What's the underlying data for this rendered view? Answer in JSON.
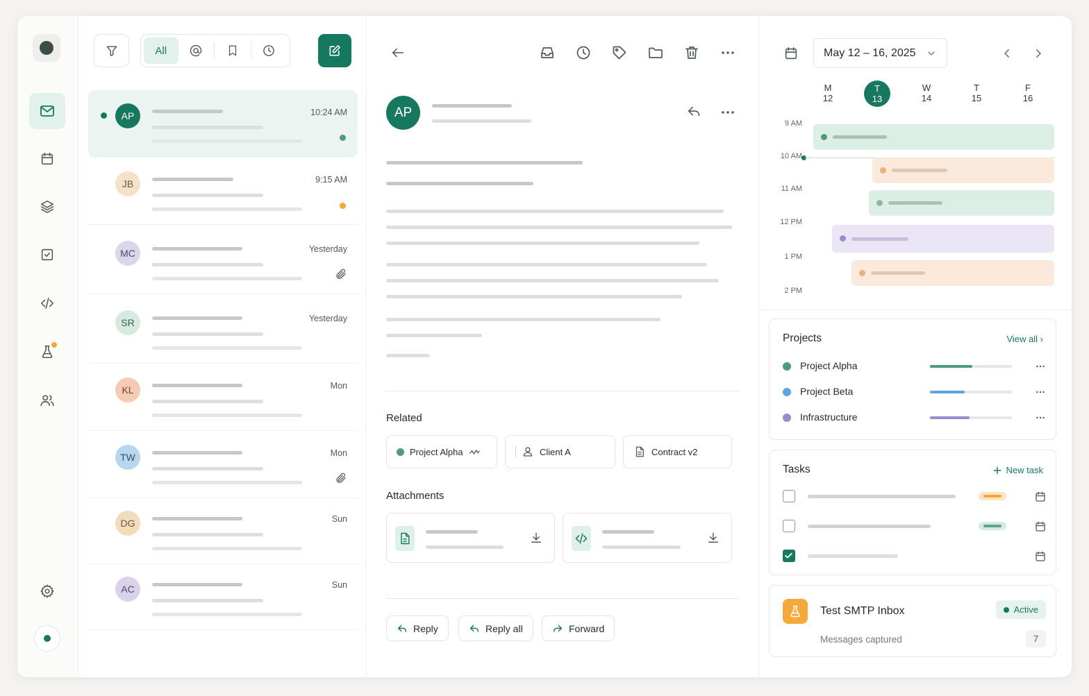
{
  "colors": {
    "accent": "#16785f",
    "warning": "#f0a93a",
    "blue": "#5aa6dd",
    "purple": "#9b8ad0"
  },
  "rail": {
    "items": [
      {
        "name": "mail",
        "icon": "mail-icon",
        "active": true
      },
      {
        "name": "calendar",
        "icon": "calendar-icon"
      },
      {
        "name": "layers",
        "icon": "layers-icon"
      },
      {
        "name": "tasks",
        "icon": "checkbox-icon"
      },
      {
        "name": "code",
        "icon": "code-icon"
      },
      {
        "name": "lab",
        "icon": "flask-icon",
        "badge": true
      },
      {
        "name": "contacts",
        "icon": "users-icon"
      }
    ],
    "settings_icon": "gear-icon"
  },
  "mail_list": {
    "filter_icon": "filter-icon",
    "tabs": {
      "all": "All",
      "mentions_icon": "at-icon",
      "saved_icon": "bookmark-icon",
      "snoozed_icon": "clock-icon"
    },
    "compose_icon": "compose-icon",
    "items": [
      {
        "initials": "AP",
        "time": "10:24 AM",
        "selected": true,
        "unread": true,
        "indicator": "#4f9a7d",
        "avatar_bg": "#16785f",
        "avatar_fg": "#ffffff"
      },
      {
        "initials": "JB",
        "time": "9:15 AM",
        "indicator": "#f0a93a",
        "avatar_bg": "#f4e1c9",
        "avatar_fg": "#6b5a3e"
      },
      {
        "initials": "MC",
        "time": "Yesterday",
        "attachment": true,
        "avatar_bg": "#dcd6ea",
        "avatar_fg": "#4f4a66"
      },
      {
        "initials": "SR",
        "time": "Yesterday",
        "avatar_bg": "#d6eadf",
        "avatar_fg": "#3f5a4b"
      },
      {
        "initials": "KL",
        "time": "Mon",
        "avatar_bg": "#f6cbb3",
        "avatar_fg": "#6b4636"
      },
      {
        "initials": "TW",
        "time": "Mon",
        "attachment": true,
        "avatar_bg": "#b9d6ef",
        "avatar_fg": "#33506b"
      },
      {
        "initials": "DG",
        "time": "Sun",
        "avatar_bg": "#f1dcbc",
        "avatar_fg": "#6b5a3e"
      },
      {
        "initials": "AC",
        "time": "Sun",
        "avatar_bg": "#d9d2ea",
        "avatar_fg": "#4f4a66"
      }
    ]
  },
  "message": {
    "sender_initials": "AP",
    "related_title": "Related",
    "related": [
      {
        "label": "Project Alpha",
        "icon": "trend-icon"
      },
      {
        "label": "Client A",
        "icon": "user-icon"
      },
      {
        "label": "Contract v2",
        "icon": "document-icon"
      }
    ],
    "attachments_title": "Attachments",
    "attachments": [
      {
        "icon": "document-icon"
      },
      {
        "icon": "code-icon"
      }
    ],
    "actions": {
      "reply": "Reply",
      "reply_all": "Reply all",
      "forward": "Forward"
    }
  },
  "calendar": {
    "range": "May 12 – 16, 2025",
    "days": [
      {
        "dow": "M",
        "date": "12"
      },
      {
        "dow": "T",
        "date": "13",
        "today": true
      },
      {
        "dow": "W",
        "date": "14"
      },
      {
        "dow": "T",
        "date": "15"
      },
      {
        "dow": "F",
        "date": "16"
      }
    ],
    "hours": [
      "9 AM",
      "10 AM",
      "11 AM",
      "12 PM",
      "1 PM",
      "2 PM"
    ],
    "events": [
      {
        "color": "green",
        "hour": "9 AM"
      },
      {
        "color": "orange",
        "hour": "10 AM"
      },
      {
        "color": "green",
        "hour": "11 AM"
      },
      {
        "color": "purple",
        "hour": "12 PM"
      },
      {
        "color": "orange",
        "hour": "1 PM"
      }
    ]
  },
  "projects": {
    "title": "Projects",
    "view_all": "View all",
    "items": [
      {
        "name": "Project Alpha",
        "color": "#4f9a7d",
        "progress": 0.52
      },
      {
        "name": "Project Beta",
        "color": "#5aa6dd",
        "progress": 0.42
      },
      {
        "name": "Infrastructure",
        "color": "#9b8ad0",
        "progress": 0.48
      }
    ]
  },
  "tasks": {
    "title": "Tasks",
    "new_task": "New task",
    "items": [
      {
        "done": false,
        "priority": "high"
      },
      {
        "done": false,
        "priority": "low"
      },
      {
        "done": true
      }
    ]
  },
  "smtp": {
    "title": "Test SMTP Inbox",
    "status": "Active",
    "captured_label": "Messages captured",
    "captured_count": "7"
  }
}
